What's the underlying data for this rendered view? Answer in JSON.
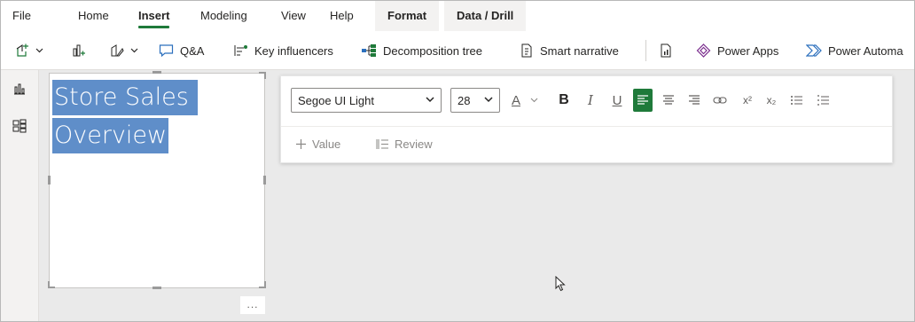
{
  "menu": {
    "file": "File",
    "home": "Home",
    "insert": "Insert",
    "modeling": "Modeling",
    "view": "View",
    "help": "Help",
    "format": "Format",
    "data_drill": "Data / Drill"
  },
  "ribbon": {
    "qna": "Q&A",
    "key_influencers": "Key influencers",
    "decomposition_tree": "Decomposition tree",
    "smart_narrative": "Smart narrative",
    "power_apps": "Power Apps",
    "power_automate": "Power Automa"
  },
  "textbox": {
    "line1": "Store Sales",
    "line2": "Overview",
    "more": "..."
  },
  "format_toolbar": {
    "font_family": "Segoe UI Light",
    "font_size": "28",
    "font_color_label": "A",
    "bold": "B",
    "italic": "I",
    "underline": "U",
    "superscript": "x²",
    "subscript": "x₂",
    "value_button": "Value",
    "review_button": "Review"
  },
  "colors": {
    "accent_green": "#1f7a3a",
    "selection_blue": "#5f8ec9",
    "canvas_gray": "#eaeaea"
  }
}
